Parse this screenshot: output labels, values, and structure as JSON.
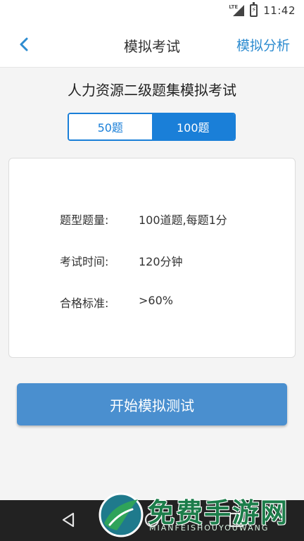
{
  "status_bar": {
    "network_label": "LTE",
    "time": "11:42"
  },
  "header": {
    "title": "模拟考试",
    "action_label": "模拟分析"
  },
  "exam": {
    "title": "人力资源二级题集模拟考试",
    "options": [
      {
        "label": "50题",
        "selected": false
      },
      {
        "label": "100题",
        "selected": true
      }
    ]
  },
  "info": {
    "rows": [
      {
        "label": "题型题量:",
        "value": "100道题,每题1分"
      },
      {
        "label": "考试时间:",
        "value": "120分钟"
      },
      {
        "label": "合格标准:",
        "value": ">60%"
      }
    ]
  },
  "start_button_label": "开始模拟测试",
  "watermark": {
    "text": "免费手游网",
    "sub": "MIANFEISHOUYOUWANG"
  },
  "colors": {
    "accent": "#1a7fd8",
    "header_action": "#2d8cd0",
    "start_button": "#4a8fcf",
    "nav_bar": "#222222",
    "watermark_green": "#1c7d4a"
  }
}
